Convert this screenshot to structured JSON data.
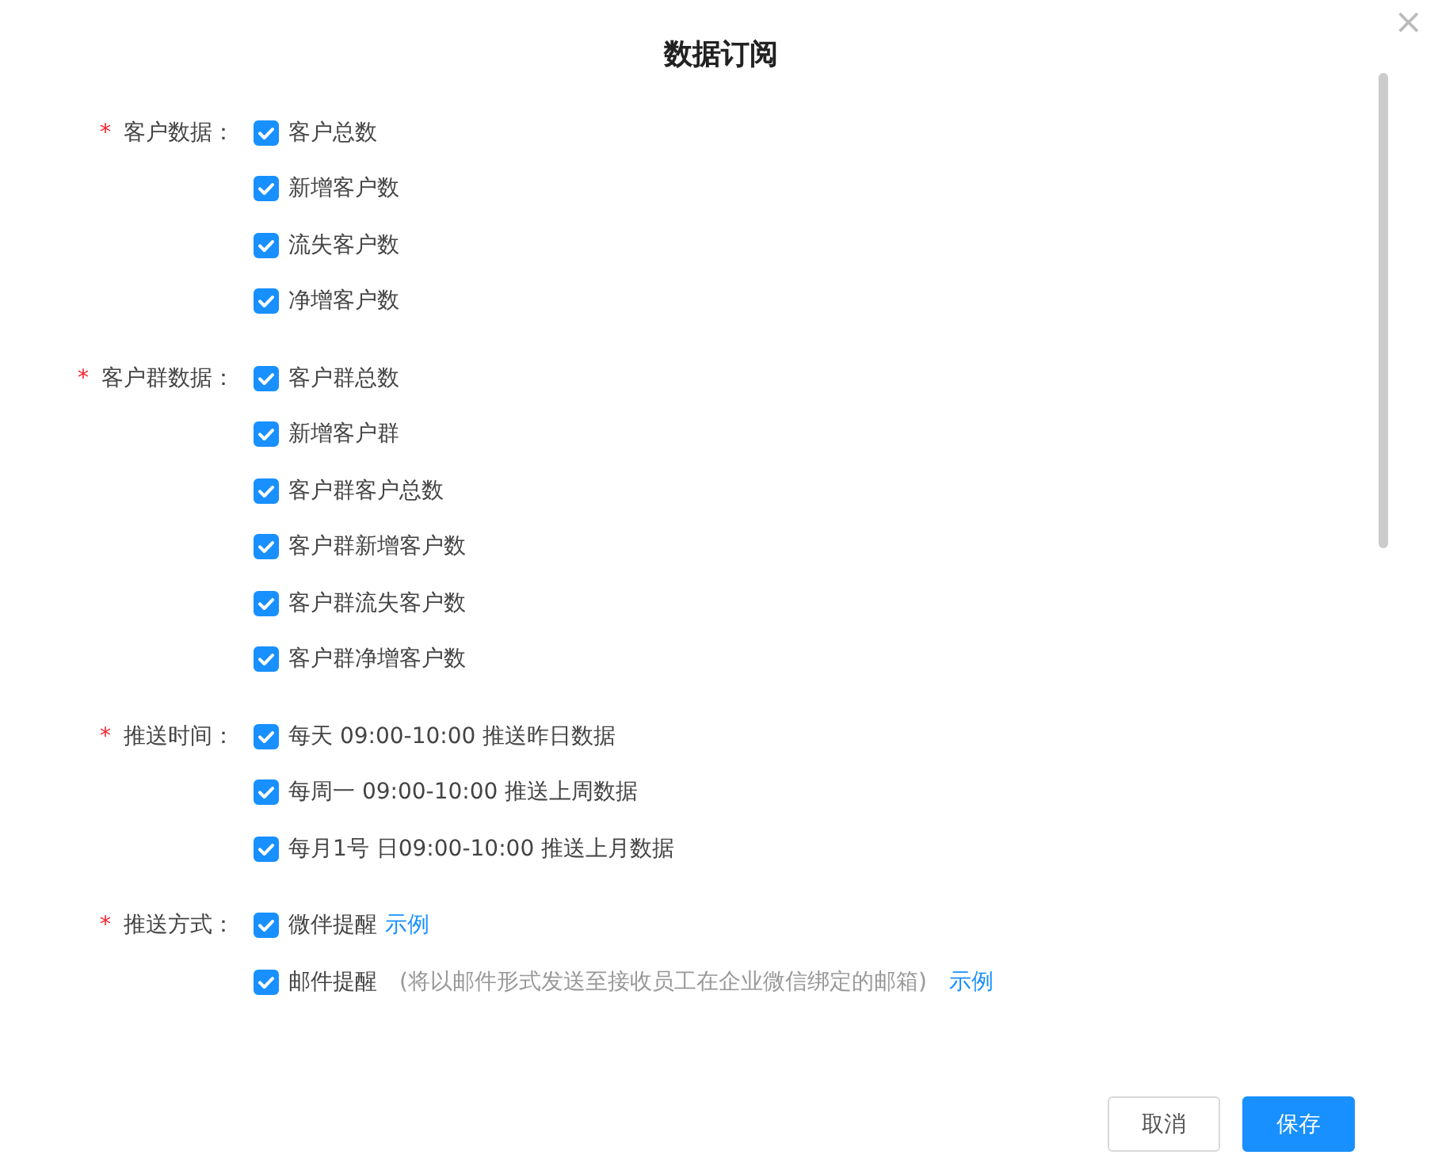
{
  "dialog": {
    "title": "数据订阅",
    "close": "×"
  },
  "groups": [
    {
      "label": "客户数据：",
      "required_mark": "*",
      "options": [
        {
          "label": "客户总数",
          "checked": true
        },
        {
          "label": "新增客户数",
          "checked": true
        },
        {
          "label": "流失客户数",
          "checked": true
        },
        {
          "label": "净增客户数",
          "checked": true
        }
      ]
    },
    {
      "label": "客户群数据：",
      "required_mark": "*",
      "options": [
        {
          "label": "客户群总数",
          "checked": true
        },
        {
          "label": "新增客户群",
          "checked": true
        },
        {
          "label": "客户群客户总数",
          "checked": true
        },
        {
          "label": "客户群新增客户数",
          "checked": true
        },
        {
          "label": "客户群流失客户数",
          "checked": true
        },
        {
          "label": "客户群净增客户数",
          "checked": true
        }
      ]
    },
    {
      "label": "推送时间：",
      "required_mark": "*",
      "options": [
        {
          "label": "每天 09:00-10:00 推送昨日数据",
          "checked": true
        },
        {
          "label": "每周一 09:00-10:00 推送上周数据",
          "checked": true
        },
        {
          "label": "每月1号 日09:00-10:00 推送上月数据",
          "checked": true
        }
      ]
    },
    {
      "label": "推送方式：",
      "required_mark": "*",
      "options": [
        {
          "label": "微伴提醒",
          "checked": true,
          "link": "示例"
        },
        {
          "label": "邮件提醒",
          "checked": true,
          "note": "(将以邮件形式发送至接收员工在企业微信绑定的邮箱)",
          "link": "示例"
        }
      ]
    }
  ],
  "buttons": [
    {
      "label": "取消",
      "kind": "default"
    },
    {
      "label": "保存",
      "kind": "primary"
    }
  ]
}
